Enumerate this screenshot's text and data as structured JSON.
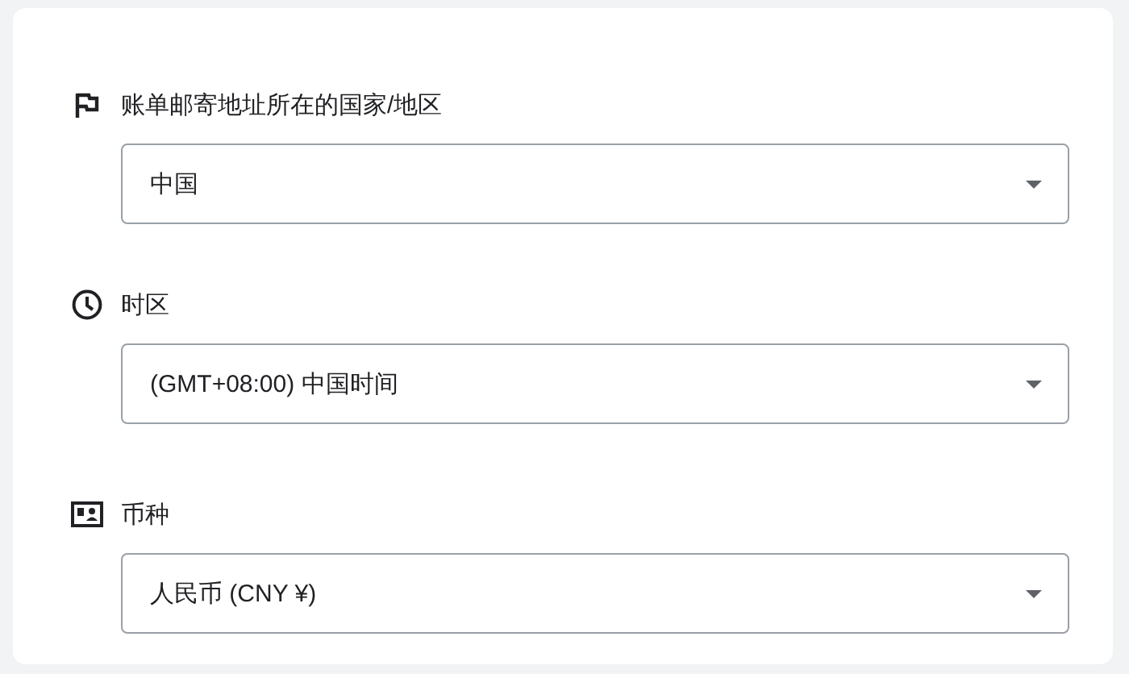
{
  "fields": [
    {
      "label": "账单邮寄地址所在的国家/地区",
      "value": "中国"
    },
    {
      "label": "时区",
      "value": "(GMT+08:00) 中国时间"
    },
    {
      "label": "币种",
      "value": "人民币 (CNY ¥)"
    }
  ]
}
